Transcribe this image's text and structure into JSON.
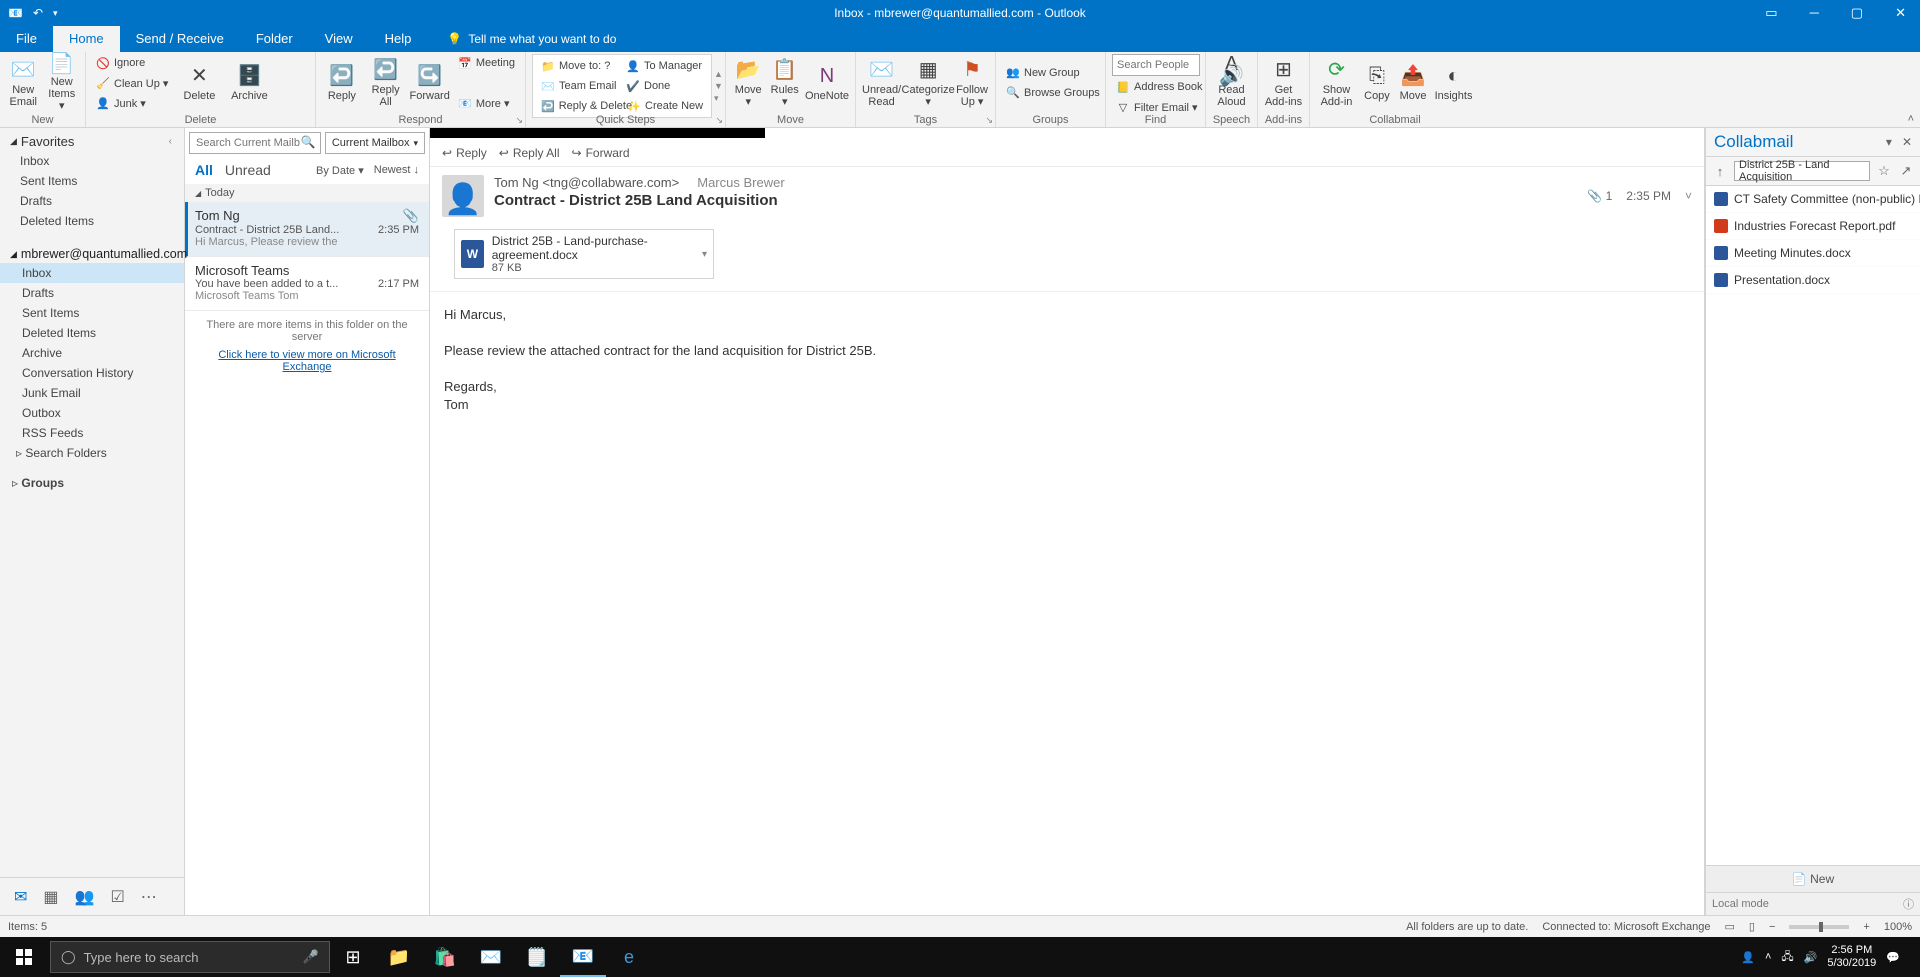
{
  "titlebar": {
    "title": "Inbox - mbrewer@quantumallied.com  -  Outlook"
  },
  "menu": {
    "tabs": [
      "File",
      "Home",
      "Send / Receive",
      "Folder",
      "View",
      "Help"
    ],
    "active": 1,
    "tell_me": "Tell me what you want to do"
  },
  "ribbon": {
    "new": {
      "email": "New Email",
      "items": "New Items ▾",
      "label": "New"
    },
    "delete": {
      "ignore": "Ignore",
      "clean": "Clean Up ▾",
      "junk": "Junk ▾",
      "delete": "Delete",
      "archive": "Archive",
      "label": "Delete"
    },
    "respond": {
      "reply": "Reply",
      "replyall": "Reply All",
      "forward": "Forward",
      "meeting": "Meeting",
      "more": "More ▾",
      "label": "Respond"
    },
    "quicksteps": {
      "move": "Move to: ?",
      "team": "Team Email",
      "replyd": "Reply & Delete",
      "mgr": "To Manager",
      "done": "Done",
      "create": "Create New",
      "label": "Quick Steps"
    },
    "move": {
      "move": "Move ▾",
      "rules": "Rules ▾",
      "onenote": "OneNote",
      "label": "Move"
    },
    "tags": {
      "unread": "Unread/ Read",
      "cat": "Categorize ▾",
      "follow": "Follow Up ▾",
      "label": "Tags"
    },
    "groups": {
      "new": "New Group",
      "browse": "Browse Groups",
      "label": "Groups"
    },
    "find": {
      "search_ph": "Search People",
      "ab": "Address Book",
      "filter": "Filter Email ▾",
      "label": "Find"
    },
    "speech": {
      "read": "Read Aloud",
      "label": "Speech"
    },
    "addins": {
      "get": "Get Add-ins",
      "label": "Add-ins"
    },
    "collabmail": {
      "show": "Show Add-in",
      "copy": "Copy",
      "move": "Move",
      "insights": "Insights",
      "label": "Collabmail"
    }
  },
  "nav": {
    "favorites": "Favorites",
    "fav_items": [
      "Inbox",
      "Sent Items",
      "Drafts",
      "Deleted Items"
    ],
    "account": "mbrewer@quantumallied.com",
    "folders": [
      "Inbox",
      "Drafts",
      "Sent Items",
      "Deleted Items",
      "Archive",
      "Conversation History",
      "Junk Email",
      "Outbox",
      "RSS Feeds",
      "Search Folders"
    ],
    "groups": "Groups"
  },
  "msglist": {
    "search_ph": "Search Current Mailbox",
    "scope": "Current Mailbox",
    "tab_all": "All",
    "tab_unread": "Unread",
    "sort1": "By Date ▾",
    "sort2": "Newest ↓",
    "dayhdr": "Today",
    "items": [
      {
        "from": "Tom Ng",
        "subj": "Contract - District 25B Land...",
        "prev": "Hi Marcus,   Please review the",
        "time": "2:35 PM",
        "att": true
      },
      {
        "from": "Microsoft Teams",
        "subj": "You have been added to a t...",
        "prev": "Microsoft Teams        Tom",
        "time": "2:17 PM",
        "att": false
      }
    ],
    "more_text": "There are more items in this folder on the server",
    "more_link": "Click here to view more on Microsoft Exchange"
  },
  "reading": {
    "reply": "Reply",
    "replyall": "Reply All",
    "forward": "Forward",
    "from": "Tom Ng <tng@collabware.com>",
    "to": "Marcus Brewer",
    "subject": "Contract - District 25B Land Acquisition",
    "att_count": "1",
    "time": "2:35 PM",
    "attachment": {
      "name": "District 25B - Land-purchase-agreement.docx",
      "size": "87 KB"
    },
    "body": {
      "l1": "Hi Marcus,",
      "l2": "Please review the attached contract for the land acquisition for District 25B.",
      "l3": "Regards,",
      "l4": "Tom"
    }
  },
  "collab": {
    "title": "Collabmail",
    "path": "District 25B - Land Acquisition",
    "items": [
      {
        "icon": "word",
        "name": "CT Safety Committee (non-public) Me..."
      },
      {
        "icon": "pdf",
        "name": "Industries Forecast Report.pdf"
      },
      {
        "icon": "word",
        "name": "Meeting Minutes.docx"
      },
      {
        "icon": "word",
        "name": "Presentation.docx"
      }
    ],
    "new": "New",
    "mode": "Local mode"
  },
  "status": {
    "items": "Items: 5",
    "sync": "All folders are up to date.",
    "conn": "Connected to: Microsoft Exchange",
    "zoom": "100%"
  },
  "taskbar": {
    "search_ph": "Type here to search",
    "time": "2:56 PM",
    "date": "5/30/2019"
  }
}
